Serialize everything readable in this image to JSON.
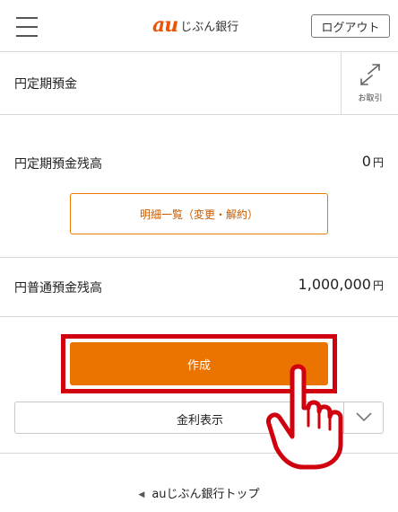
{
  "header": {
    "logo_au": "au",
    "logo_bank": "じぶん銀行",
    "logout_label": "ログアウト"
  },
  "page": {
    "title": "円定期預金",
    "transfer_label": "お取引"
  },
  "balances": {
    "time_deposit_label": "円定期預金残高",
    "time_deposit_value": "0",
    "time_deposit_unit": "円",
    "ordinary_deposit_label": "円普通預金残高",
    "ordinary_deposit_value": "1,000,000",
    "ordinary_deposit_unit": "円"
  },
  "actions": {
    "detail_list_label": "明細一覧（変更・解約）",
    "create_label": "作成",
    "interest_rate_label": "金利表示"
  },
  "footer": {
    "top_link_label": "auじぶん銀行トップ"
  },
  "colors": {
    "accent": "#eb7300",
    "brand": "#eb5505",
    "highlight": "#d0000e"
  },
  "icons": {
    "menu": "hamburger-menu-icon",
    "transfer": "transfer-arrows-icon",
    "chevron": "chevron-down-icon",
    "pointer": "pointing-hand-icon",
    "triangle": "triangle-left-icon"
  }
}
